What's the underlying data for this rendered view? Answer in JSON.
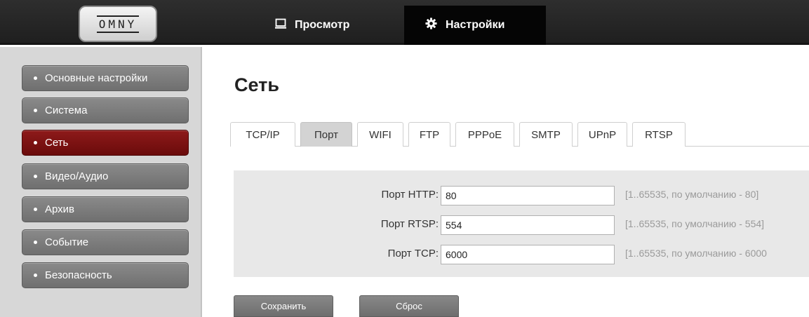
{
  "header": {
    "logo_text": "OMNY",
    "view_label": "Просмотр",
    "settings_label": "Настройки"
  },
  "sidebar": {
    "items": [
      {
        "label": "Основные настройки",
        "active": false
      },
      {
        "label": "Система",
        "active": false
      },
      {
        "label": "Сеть",
        "active": true
      },
      {
        "label": "Видео/Аудио",
        "active": false
      },
      {
        "label": "Архив",
        "active": false
      },
      {
        "label": "Событие",
        "active": false
      },
      {
        "label": "Безопасность",
        "active": false
      }
    ]
  },
  "main": {
    "title": "Сеть",
    "tabs": [
      "TCP/IP",
      "Порт",
      "WIFI",
      "FTP",
      "PPPoE",
      "SMTP",
      "UPnP",
      "RTSP"
    ],
    "active_tab": "Порт",
    "fields": [
      {
        "label": "Порт HTTP:",
        "value": "80",
        "hint": "[1..65535, по умолчанию - 80]"
      },
      {
        "label": "Порт RTSP:",
        "value": "554",
        "hint": "[1..65535, по умолчанию - 554]"
      },
      {
        "label": "Порт TCP:",
        "value": "6000",
        "hint": "[1..65535, по умолчанию - 6000"
      }
    ],
    "save_label": "Сохранить",
    "reset_label": "Сброс"
  },
  "colors": {
    "topbar": "#252525",
    "active_nav": "#050505",
    "active_sidebar": "#7d1111",
    "sidebar_item": "#7c7c7c"
  }
}
